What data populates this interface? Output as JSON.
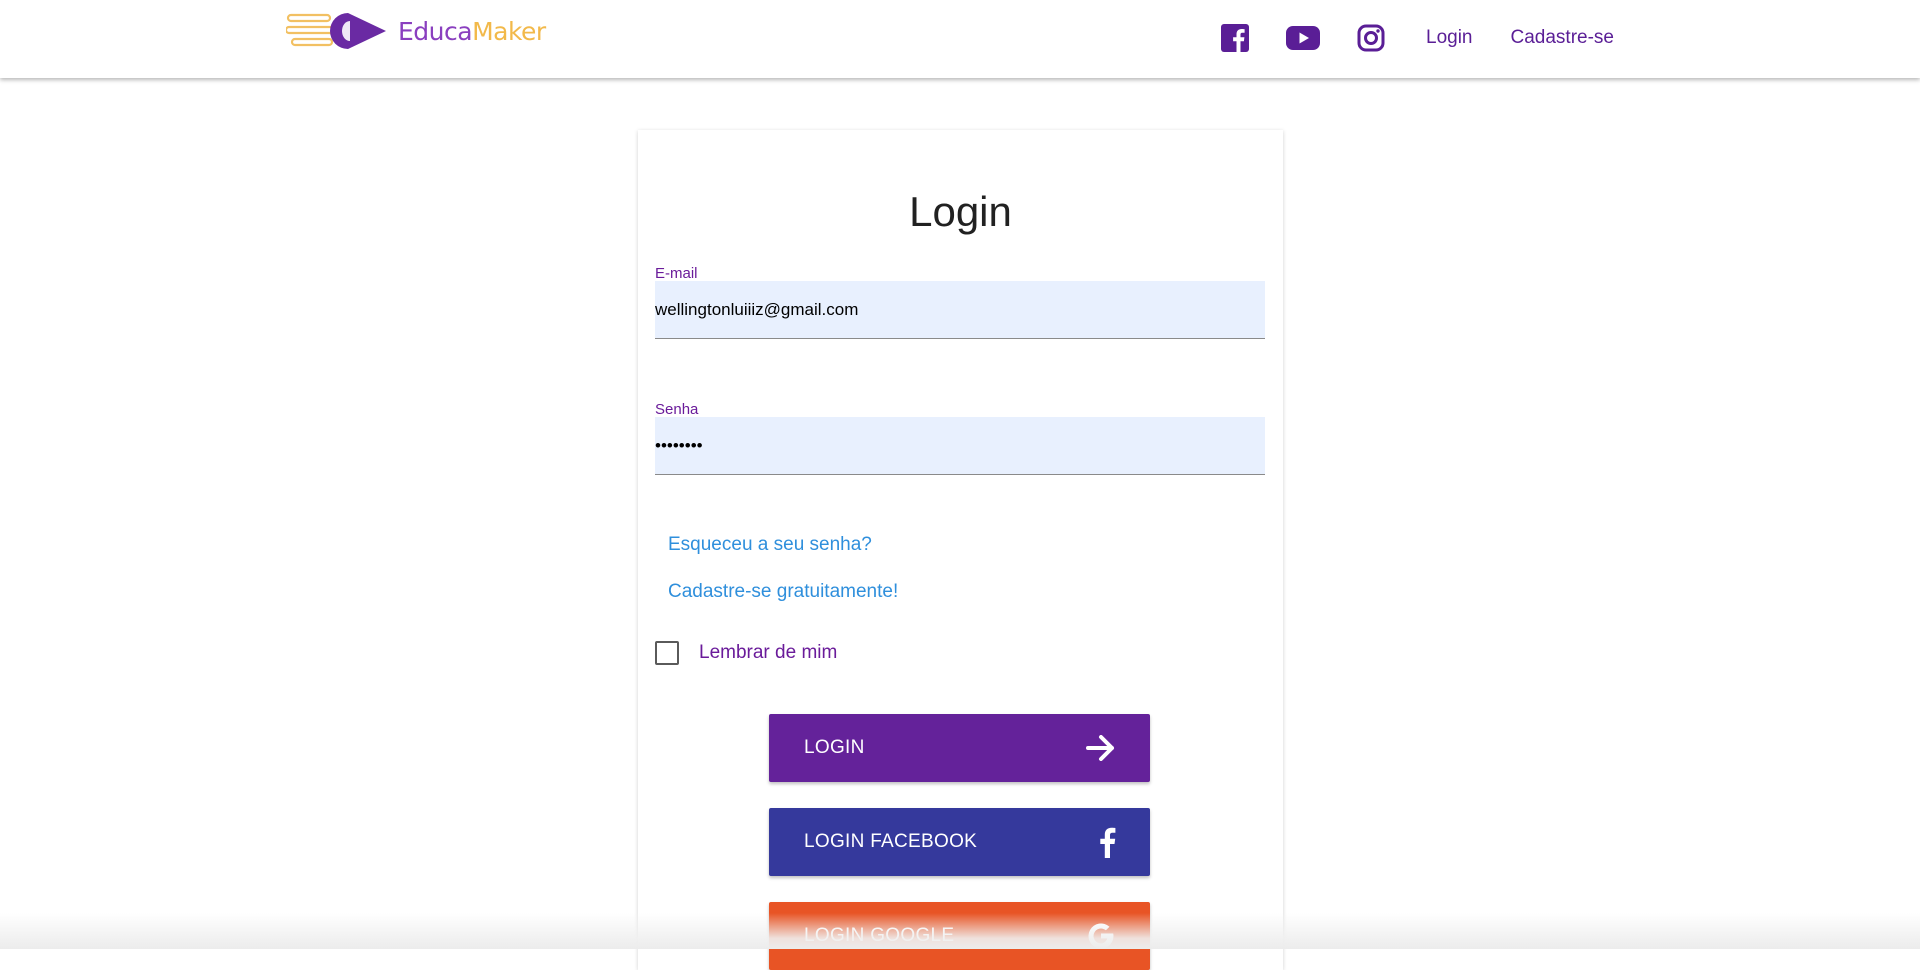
{
  "navbar": {
    "brand_part1": "Educa",
    "brand_part2": "Maker",
    "icons": [
      "facebook-icon",
      "youtube-icon",
      "instagram-icon"
    ],
    "login_link": "Login",
    "signup_link": "Cadastre-se"
  },
  "login_form": {
    "title": "Login",
    "email": {
      "label": "E-mail",
      "value": "wellingtonluiiiz@gmail.com"
    },
    "password": {
      "label": "Senha",
      "value": "••••••••"
    },
    "forgot_link": "Esqueceu a seu senha?",
    "signup_link": "Cadastre-se gratuitamente!",
    "remember_label": "Lembrar de mim",
    "remember_checked": false,
    "buttons": {
      "login": "LOGIN",
      "facebook": "LOGIN FACEBOOK",
      "google": "LOGIN GOOGLE"
    }
  },
  "colors": {
    "primary": "#64229a",
    "facebook_button": "#35399c",
    "google_button": "#e85425",
    "link": "#2f8fdc",
    "input_bg": "#e8f0fe",
    "logo_purple": "#8a3fbf",
    "logo_yellow": "#f2b94a"
  }
}
